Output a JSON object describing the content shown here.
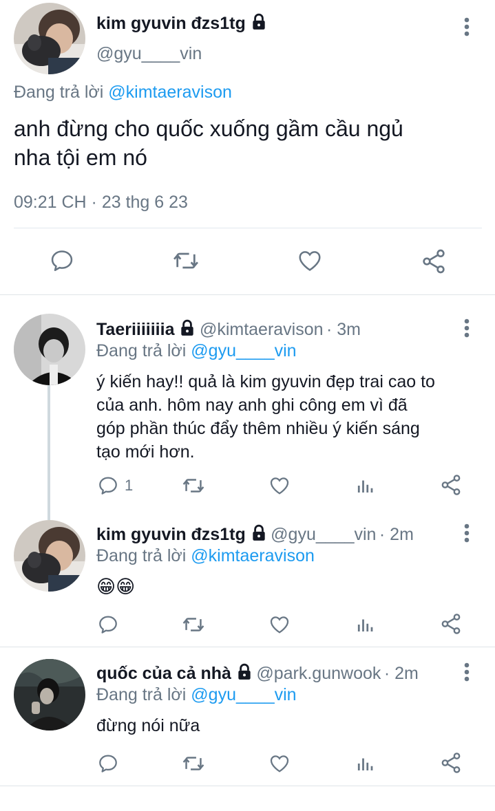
{
  "colors": {
    "accent": "#1d9bf0",
    "muted": "#687684",
    "text": "#141823",
    "divider": "#e1e8ed"
  },
  "main_tweet": {
    "author_name": "kim gyuvin đzs1tg",
    "handle": "@gyu____vin",
    "reply_prefix": "Đang trả lời",
    "reply_to": "@kimtaeravison",
    "text_line1": "anh đừng cho quốc xuống gầm cầu ngủ",
    "text_line2": "nha tội em nó",
    "timestamp": "09:21 CH · 23 thg 6 23",
    "actions": [
      "reply-icon",
      "retweet-icon",
      "like-icon",
      "share-icon"
    ]
  },
  "replies": [
    {
      "author_name": "Taeriiiiiiia",
      "handle": "@kimtaeravison",
      "time": "· 3m",
      "reply_prefix": "Đang trả lời",
      "reply_to": "@gyu____vin",
      "text_lines": [
        "ý kiến hay!! quả là kim gyuvin đẹp trai cao to",
        "của anh. hôm nay anh ghi công em vì đã",
        "góp phần thúc đẩy thêm nhiều ý kiến sáng",
        "tạo mới hơn."
      ],
      "reply_count": "1"
    },
    {
      "author_name": "kim gyuvin đzs1tg",
      "handle": "@gyu____vin",
      "time": "· 2m",
      "reply_prefix": "Đang trả lời",
      "reply_to": "@kimtaeravison",
      "text_lines": [
        "😁😁"
      ],
      "reply_count": ""
    },
    {
      "author_name": "quốc của cả nhà",
      "handle": "@park.gunwook",
      "time": "· 2m",
      "reply_prefix": "Đang trả lời",
      "reply_to": "@gyu____vin",
      "text_lines": [
        "đừng nói nữa"
      ],
      "reply_count": ""
    }
  ]
}
